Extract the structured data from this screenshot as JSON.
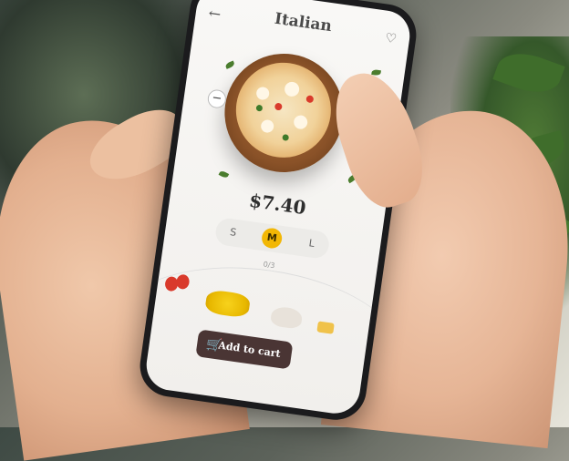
{
  "header": {
    "title": "Italian",
    "back_icon": "arrow-left-icon",
    "favorite_icon": "heart-icon"
  },
  "product": {
    "price": "$7.40",
    "quantity_minus": "−",
    "quantity_plus": "+"
  },
  "size_selector": {
    "options": [
      "S",
      "M",
      "L"
    ],
    "selected": "M"
  },
  "ingredients": {
    "count": "0/3",
    "items": [
      "tomato",
      "corn",
      "mushroom",
      "pasta"
    ]
  },
  "cart": {
    "label": "Add to cart",
    "icon": "cart-icon"
  },
  "colors": {
    "accent": "#f2b705",
    "cart_button": "#4a3534",
    "screen_bg": "#f9f8f6"
  }
}
